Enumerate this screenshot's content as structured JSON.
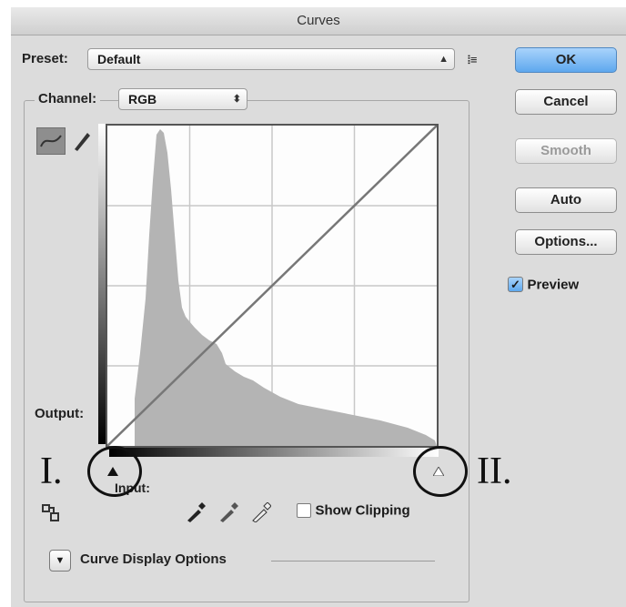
{
  "dialog": {
    "title": "Curves"
  },
  "preset": {
    "label": "Preset:",
    "value": "Default"
  },
  "channel": {
    "label": "Channel:",
    "value": "RGB"
  },
  "buttons": {
    "ok": "OK",
    "cancel": "Cancel",
    "smooth": "Smooth",
    "auto": "Auto",
    "options": "Options..."
  },
  "preview": {
    "label": "Preview",
    "checked": true
  },
  "graph": {
    "output_label": "Output:",
    "input_label": "Input:"
  },
  "show_clipping": {
    "label": "Show Clipping",
    "checked": false
  },
  "curve_display_options": {
    "label": "Curve Display Options"
  },
  "annotations": {
    "black_point": "I.",
    "white_point": "II."
  },
  "colors": {
    "ok_button": "#5ea8ee",
    "panel": "#dcdcdc",
    "histogram": "#b4b4b4"
  }
}
